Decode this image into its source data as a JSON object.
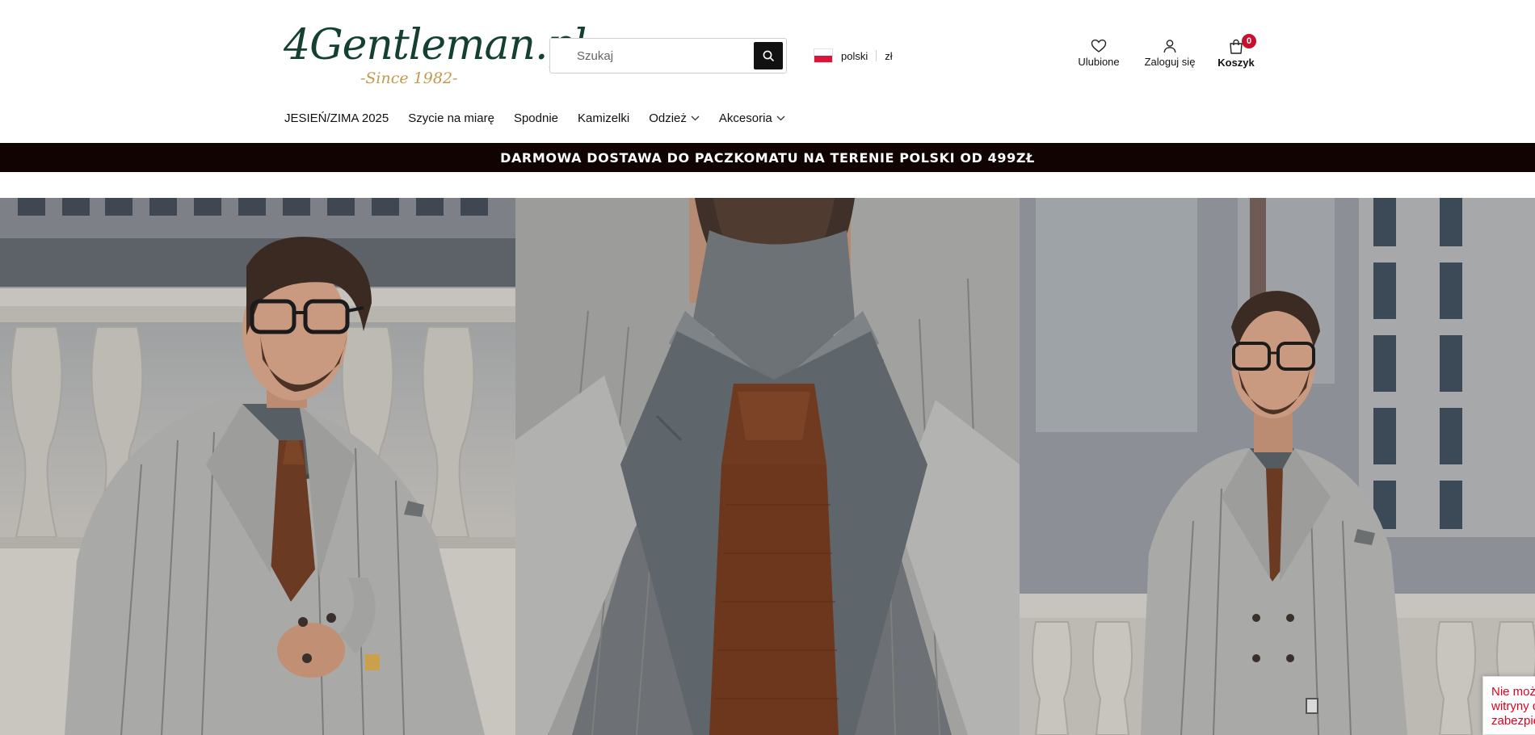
{
  "logo": {
    "wordmark": "4Gentleman.pl",
    "tagline": "-Since 1982-"
  },
  "search": {
    "placeholder": "Szukaj",
    "value": ""
  },
  "locale": {
    "language": "polski",
    "currency": "zł"
  },
  "header_icons": {
    "favorites_label": "Ulubione",
    "login_label": "Zaloguj się",
    "cart_label": "Koszyk",
    "cart_count": "0"
  },
  "nav": {
    "items": [
      {
        "label": "JESIEŃ/ZIMA 2025",
        "has_dropdown": false
      },
      {
        "label": "Szycie na miarę",
        "has_dropdown": false
      },
      {
        "label": "Spodnie",
        "has_dropdown": false
      },
      {
        "label": "Kamizelki",
        "has_dropdown": false
      },
      {
        "label": "Odzież",
        "has_dropdown": true
      },
      {
        "label": "Akcesoria",
        "has_dropdown": true
      }
    ]
  },
  "promo_bar": {
    "text": "DARMOWA DOSTAWA DO PACZKOMATU NA TERENIE POLSKI OD 499ZŁ"
  },
  "cookie_notice": {
    "lines": [
      "Nie możn",
      "witryny d",
      "zabezpie"
    ]
  },
  "colors": {
    "brand_green": "#14402f",
    "brand_gold": "#c19a4a",
    "promo_bg": "#110302",
    "badge_red": "#c8102e",
    "notice_red": "#e3001b"
  },
  "icons": [
    "search-icon",
    "heart-icon",
    "user-icon",
    "shopping-bag-icon",
    "chevron-down-icon"
  ]
}
